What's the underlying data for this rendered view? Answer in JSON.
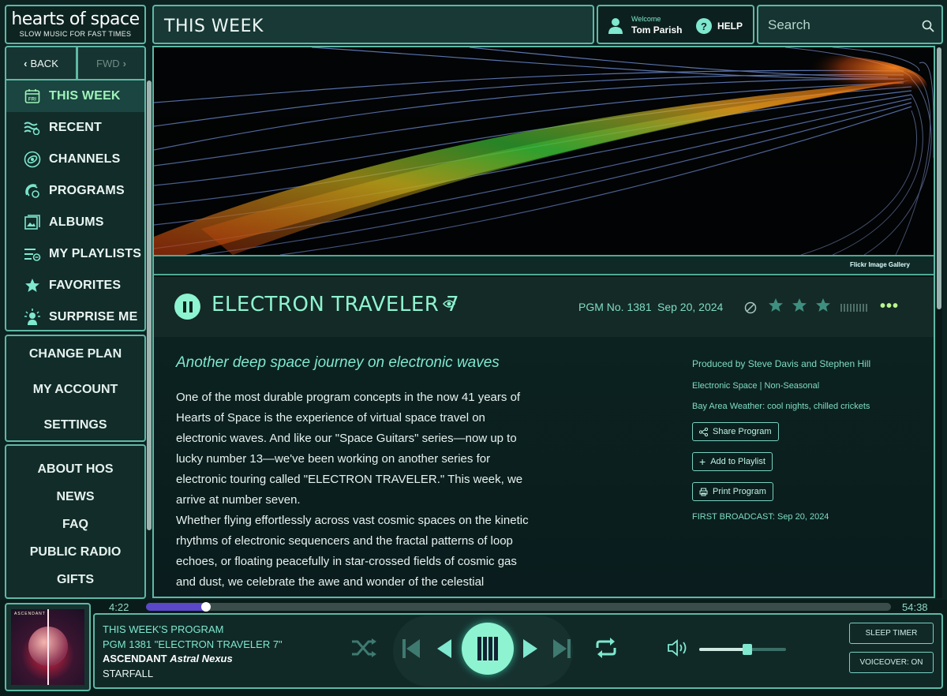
{
  "brand": {
    "name": "hearts of space",
    "tagline": "SLOW MUSIC FOR FAST TIMES"
  },
  "header": {
    "title": "THIS WEEK",
    "welcome_label": "Welcome",
    "user_name": "Tom Parish",
    "help_label": "HELP",
    "search_placeholder": "Search"
  },
  "nav_buttons": {
    "back": "BACK",
    "fwd": "FWD"
  },
  "sidebar": {
    "items": [
      {
        "label": "THIS WEEK",
        "icon": "calendar-fri-icon",
        "active": true
      },
      {
        "label": "RECENT",
        "icon": "waves-icon"
      },
      {
        "label": "CHANNELS",
        "icon": "channels-icon"
      },
      {
        "label": "PROGRAMS",
        "icon": "programs-icon"
      },
      {
        "label": "ALBUMS",
        "icon": "albums-icon"
      },
      {
        "label": "MY PLAYLISTS",
        "icon": "playlist-icon"
      },
      {
        "label": "FAVORITES",
        "icon": "star-icon"
      },
      {
        "label": "SURPRISE ME",
        "icon": "surprise-icon"
      }
    ]
  },
  "account": {
    "items": [
      "CHANGE PLAN",
      "MY ACCOUNT",
      "SETTINGS"
    ]
  },
  "about": {
    "items": [
      "ABOUT HOS",
      "NEWS",
      "FAQ",
      "PUBLIC RADIO",
      "GIFTS"
    ]
  },
  "hero": {
    "credit": "Flickr Image Gallery"
  },
  "program": {
    "title": "ELECTRON TRAVELER 7",
    "pgm": "PGM No. 1381",
    "date": "Sep 20, 2024",
    "rating": 3,
    "subtitle": "Another deep space journey on electronic waves",
    "paragraph1": "One of the most durable program concepts in the now 41 years of Hearts of Space is the experience of virtual space travel on electronic waves. And like our \"Space Guitars\" series—now up to lucky number 13—we've been working on another series for electronic touring called \"ELECTRON TRAVELER.\" This week, we arrive at number seven.",
    "paragraph2": "Whether flying effortlessly across vast cosmic spaces on the kinetic rhythms of electronic sequencers and the fractal patterns of loop echoes, or floating peacefully in star-crossed fields of cosmic gas and dust, we celebrate the awe and wonder of the celestial spectacle.",
    "produced_by": "Produced by Steve Davis and Stephen Hill",
    "genre": "Electronic Space | Non-Seasonal",
    "weather": "Bay Area Weather: cool nights, chilled crickets",
    "share_label": "Share Program",
    "playlist_label": "Add to Playlist",
    "print_label": "Print Program",
    "first_broadcast": "FIRST BROADCAST: Sep 20, 2024"
  },
  "player": {
    "elapsed": "4:22",
    "duration": "54:38",
    "progress": 0.08,
    "line1": "THIS WEEK'S PROGRAM",
    "line2": "PGM 1381 \"ELECTRON TRAVELER 7\"",
    "artist": "ASCENDANT",
    "album": "Astral Nexus",
    "track": "STARFALL",
    "cover_text": "ASCENDANT",
    "volume": 0.55,
    "sleep_label": "SLEEP TIMER",
    "voiceover_label": "VOICEOVER: ON"
  },
  "colors": {
    "accent": "#7fe8cf",
    "active": "#9ff3b9",
    "border": "#5fb8a6",
    "teal_text": "#7fdcc4"
  }
}
